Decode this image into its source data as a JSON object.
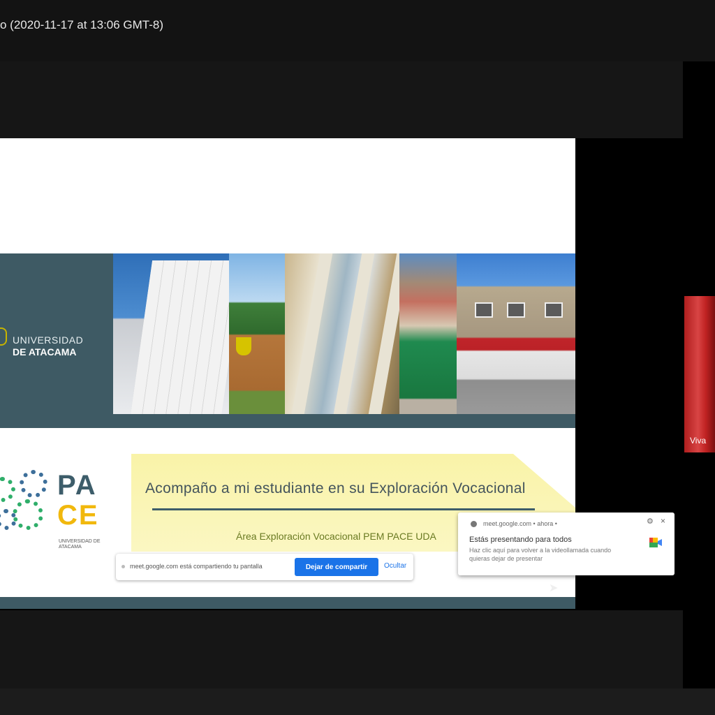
{
  "meeting": {
    "title": "o (2020-11-17 at 13:06 GMT-8)"
  },
  "slide": {
    "university_line1": "UNIVERSIDAD",
    "university_line2": "DE ATACAMA",
    "pace_line1": "PA",
    "pace_line2": "CE",
    "pace_subtitle": "UNIVERSIDAD DE ATACAMA",
    "banner_title": "Acompaño a mi estudiante en su Exploración Vocacional",
    "banner_subtitle": "Área Exploración Vocacional PEM PACE UDA"
  },
  "share_bar": {
    "message": "meet.google.com está compartiendo tu pantalla",
    "stop_label": "Dejar de compartir",
    "hide_label": "Ocultar"
  },
  "notification": {
    "source": "meet.google.com • ahora •",
    "title": "Estás presentando para todos",
    "body": "Haz clic aquí para volver a la videollamada cuando quieras dejar de presentar",
    "settings_icon": "gear-icon",
    "close_label": "×"
  },
  "participant": {
    "name": "Viva"
  },
  "colors": {
    "slide_banner": "#3e5a64",
    "pace_yellow": "#f1b80d",
    "share_button": "#1a73e8",
    "banner_yellow": "#f9f3a8"
  }
}
